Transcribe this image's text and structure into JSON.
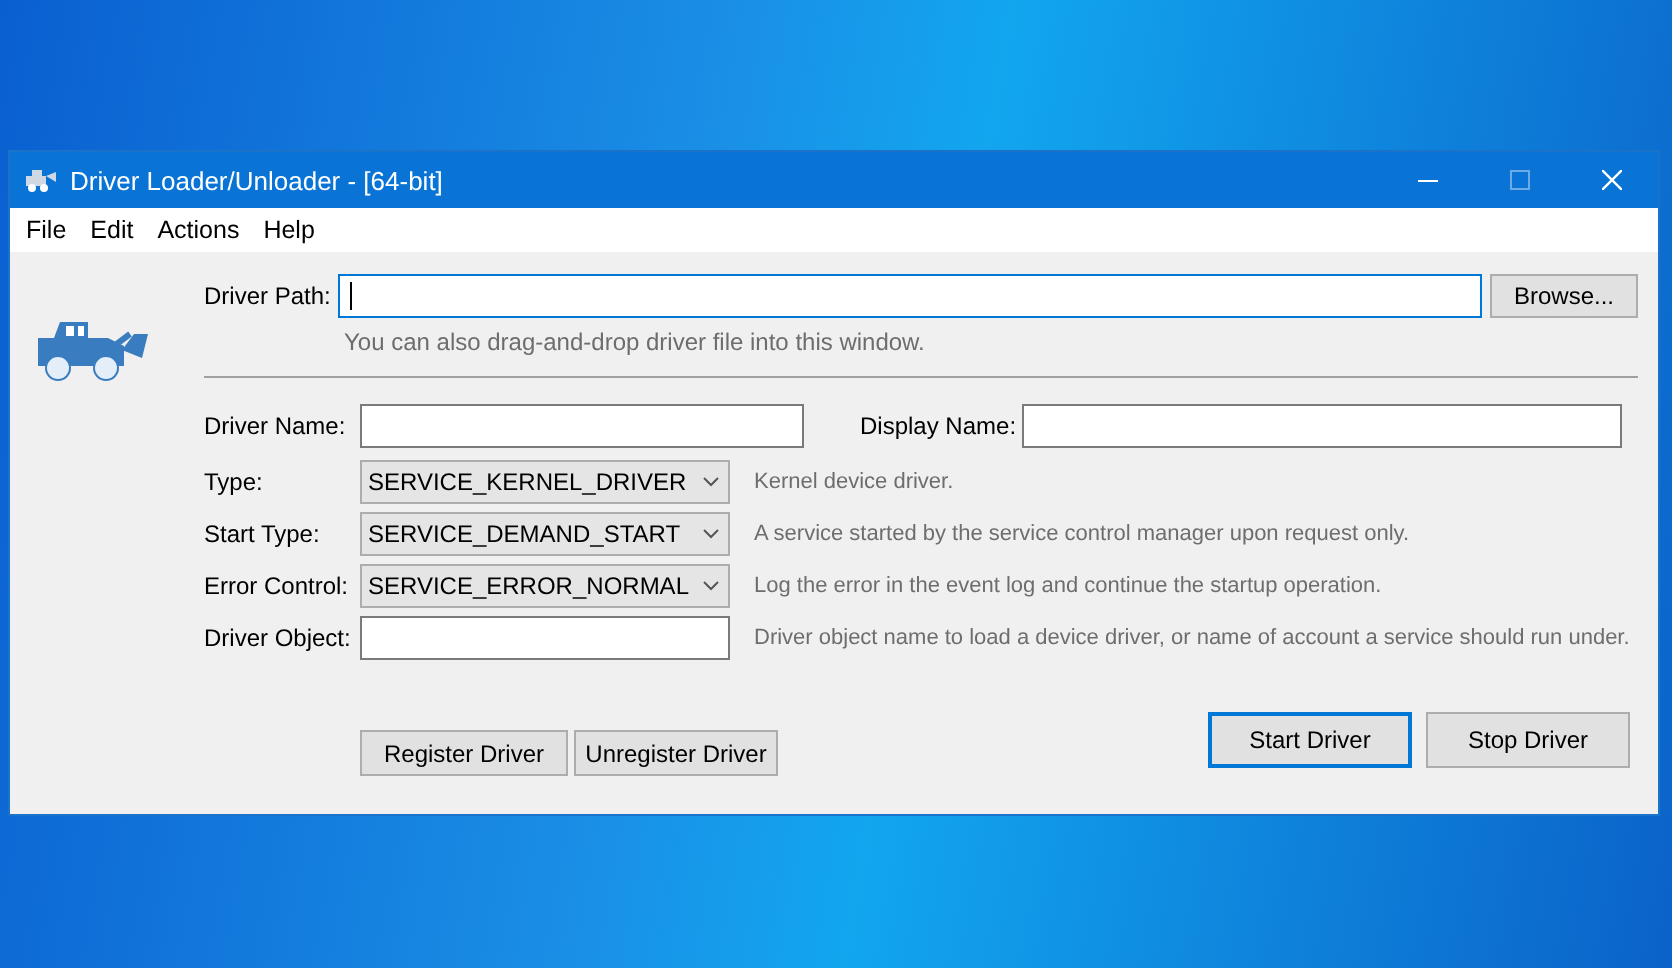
{
  "window": {
    "title": "Driver Loader/Unloader - [64-bit]",
    "maximize_disabled": true
  },
  "menu": [
    "File",
    "Edit",
    "Actions",
    "Help"
  ],
  "driver_path": {
    "label": "Driver Path:",
    "focused": true,
    "browse": "Browse...",
    "hint": "You can also drag-and-drop driver file into this window."
  },
  "driver_name": {
    "label": "Driver Name:"
  },
  "display_name": {
    "label": "Display Name:"
  },
  "options": [
    {
      "label": "Type:",
      "value": "SERVICE_KERNEL_DRIVER",
      "description": "Kernel device driver."
    },
    {
      "label": "Start Type:",
      "value": "SERVICE_DEMAND_START",
      "description": "A service started by the service control manager upon request only."
    },
    {
      "label": "Error Control:",
      "value": "SERVICE_ERROR_NORMAL",
      "description": "Log the error in the event log and continue the startup operation."
    }
  ],
  "driver_object": {
    "label": "Driver Object:",
    "description": "Driver object name to load a device driver, or name of account a service should run under."
  },
  "register_buttons": [
    {
      "label": "Register Driver",
      "default": false
    },
    {
      "label": "Unregister Driver",
      "default": false
    }
  ],
  "control_buttons": [
    {
      "label": "Start Driver",
      "default": true
    },
    {
      "label": "Stop Driver",
      "default": false
    }
  ]
}
